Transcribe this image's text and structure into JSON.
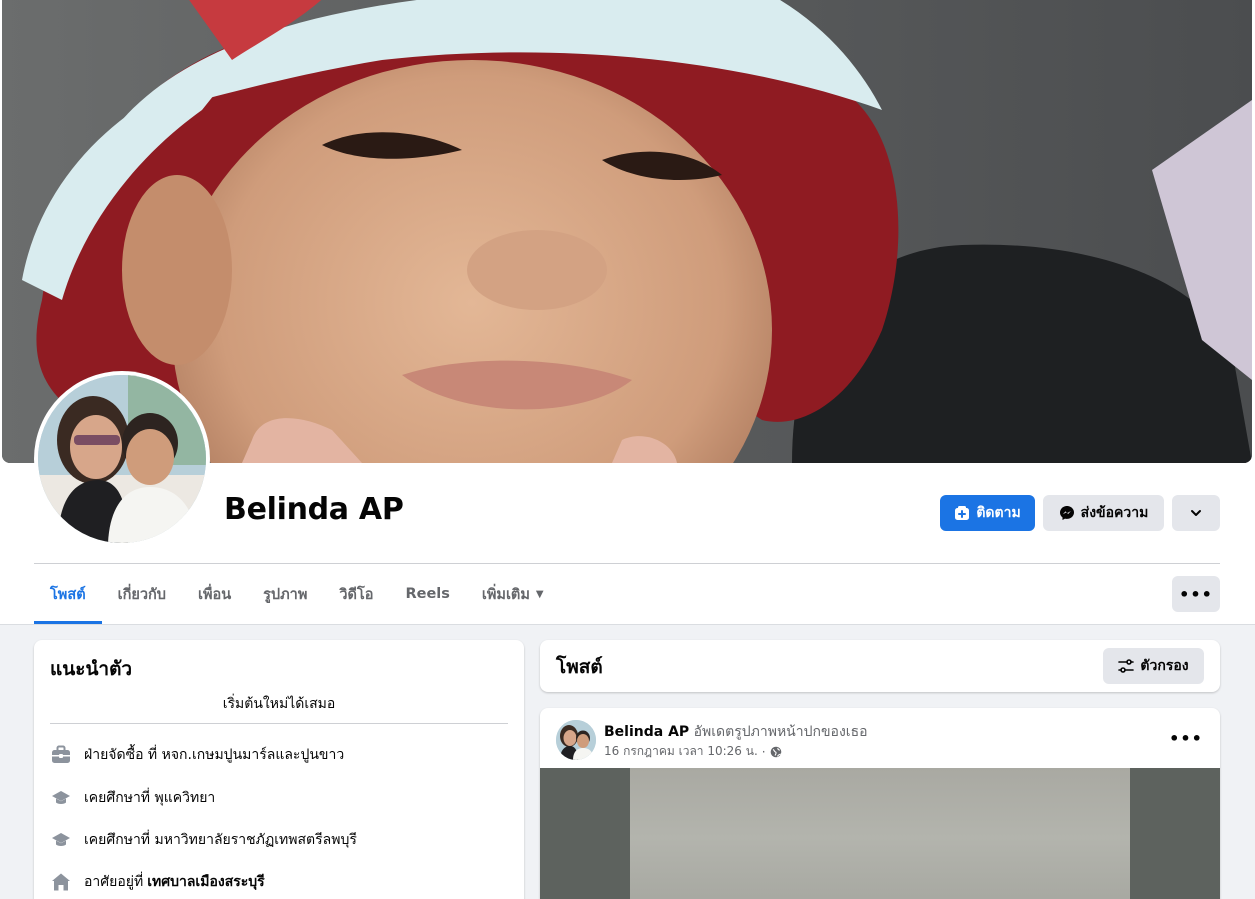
{
  "profile": {
    "name": "Belinda AP"
  },
  "actions": {
    "follow_label": "ติดตาม",
    "message_label": "ส่งข้อความ",
    "more_icon": "chevron-down-icon"
  },
  "tabs": [
    {
      "label": "โพสต์",
      "active": true
    },
    {
      "label": "เกี่ยวกับ",
      "active": false
    },
    {
      "label": "เพื่อน",
      "active": false
    },
    {
      "label": "รูปภาพ",
      "active": false
    },
    {
      "label": "วิดีโอ",
      "active": false
    },
    {
      "label": "Reels",
      "active": false
    },
    {
      "label": "เพิ่มเติม",
      "active": false
    }
  ],
  "tabs_more_icon": "ellipsis-icon",
  "intro": {
    "title": "แนะนำตัว",
    "bio": "เริ่มต้นใหม่ได้เสมอ",
    "items": [
      {
        "icon": "briefcase-icon",
        "text": "ฝ่ายจัดซื้อ ที่ หจก.เกษมปูนมาร์ลและปูนขาว",
        "bold": ""
      },
      {
        "icon": "graduation-cap-icon",
        "text": "เคยศึกษาที่ พุแควิทยา",
        "bold": ""
      },
      {
        "icon": "graduation-cap-icon",
        "text": "เคยศึกษาที่ มหาวิทยาลัยราชภัฏเทพสตรีลพบุรี",
        "bold": ""
      },
      {
        "icon": "home-icon",
        "text": "อาศัยอยู่ที่",
        "bold": "เทศบาลเมืองสระบุรี"
      }
    ]
  },
  "posts": {
    "title": "โพสต์",
    "filter_label": "ตัวกรอง"
  },
  "post": {
    "author": "Belinda AP",
    "action": "อัพเดตรูปภาพหน้าปกของเธอ",
    "timestamp": "16 กรกฎาคม เวลา 10:26 น.",
    "separator": "·",
    "privacy_icon": "globe-icon"
  },
  "colors": {
    "accent": "#1b74e4",
    "text_primary": "#050505",
    "text_secondary": "#65676b",
    "background": "#f0f2f5",
    "button_gray": "#e4e6eb"
  }
}
